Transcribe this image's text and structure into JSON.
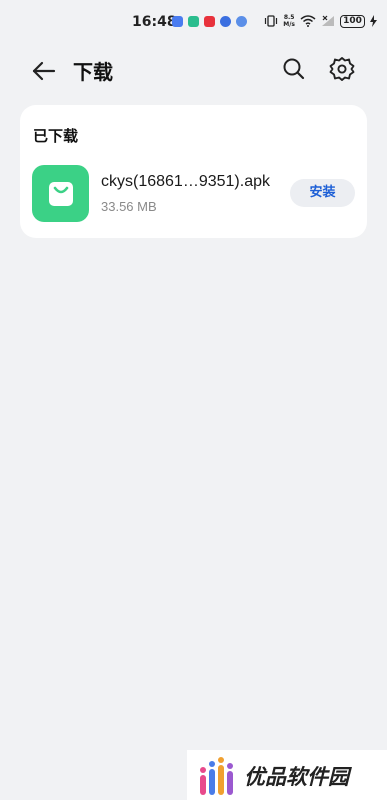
{
  "status_bar": {
    "time": "16:48",
    "net_speed_value": "8.5",
    "net_speed_unit": "M/s",
    "battery": "100"
  },
  "app_bar": {
    "title": "下载"
  },
  "downloaded": {
    "section_title": "已下载",
    "items": [
      {
        "file_name": "ckys(16861…9351).apk",
        "file_size": "33.56 MB",
        "action_label": "安装",
        "icon": "shopping-bag-icon"
      }
    ]
  },
  "watermark": {
    "text": "优品软件园"
  },
  "colors": {
    "background": "#f1f2f4",
    "app_icon": "#3bd186",
    "accent": "#1d5fd6"
  }
}
